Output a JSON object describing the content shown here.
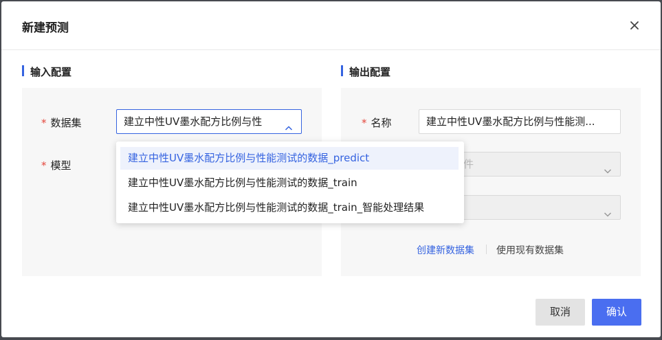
{
  "dialog": {
    "title": "新建预测"
  },
  "input_section": {
    "title": "输入配置",
    "dataset": {
      "label": "数据集",
      "required": "*",
      "value": "建立中性UV墨水配方比例与性"
    },
    "model": {
      "label": "模型",
      "required": "*"
    }
  },
  "dropdown": {
    "options": [
      "建立中性UV墨水配方比例与性能测试的数据_predict",
      "建立中性UV墨水配方比例与性能测试的数据_train",
      "建立中性UV墨水配方比例与性能测试的数据_train_智能处理结果"
    ],
    "selected_index": 0
  },
  "output_section": {
    "title": "输出配置",
    "name": {
      "label": "名称",
      "required": "*",
      "value": "建立中性UV墨水配方比例与性能测..."
    },
    "field2_value": "件",
    "create_link": "创建新数据集",
    "use_existing_link": "使用现有数据集"
  },
  "footer": {
    "cancel": "取消",
    "confirm": "确认"
  },
  "colors": {
    "accent": "#3563e0",
    "required": "#e4473c",
    "panel": "#f7f7f7"
  },
  "icons": {
    "close": "close-icon",
    "chevron_up": "chevron-up-icon",
    "chevron_down": "chevron-down-icon"
  }
}
